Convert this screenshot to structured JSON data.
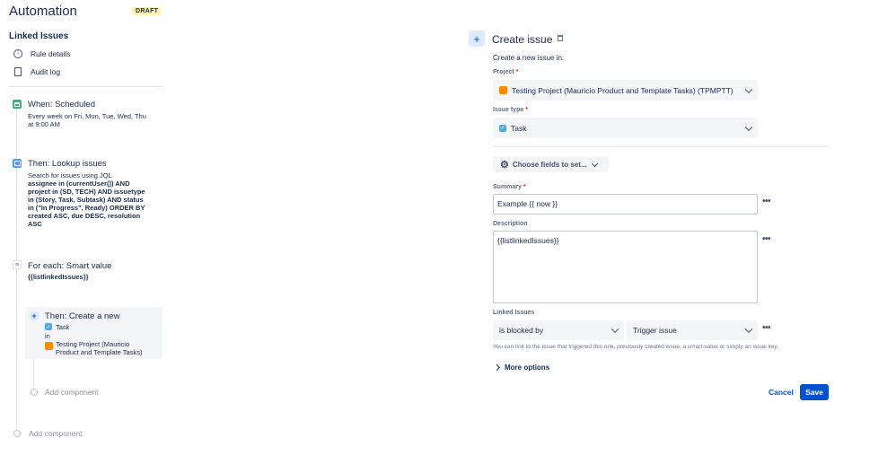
{
  "header": {
    "title": "Automation",
    "badge": "DRAFT"
  },
  "sidebar": {
    "rule_name": "Linked Issues",
    "items": [
      {
        "label": "Rule details",
        "icon": "info-icon"
      },
      {
        "label": "Audit log",
        "icon": "document-icon"
      }
    ]
  },
  "flow": {
    "trigger": {
      "title": "When: Scheduled",
      "lines": [
        "Every week on Fri, Mon, Tue, Wed, Thu",
        "at 9:00 AM"
      ]
    },
    "lookup": {
      "title": "Then: Lookup issues",
      "intro": "Search for issues using JQL",
      "jql_lines": [
        "assignee in (currentUser()) AND",
        "project in (SD, TECH) AND issuetype",
        "in (Story, Task, Subtask) AND status",
        "in (\"In Progress\", Ready) ORDER BY",
        "created ASC, due DESC, resolution",
        "ASC"
      ]
    },
    "branch": {
      "title": "For each: Smart value",
      "value": "{{listlinkedIssues}}"
    },
    "action": {
      "title": "Then: Create a new",
      "type": "Task",
      "in": "in",
      "project_lines": [
        "Testing Project (Mauricio",
        "Product and Template Tasks)"
      ]
    },
    "add_component_inner": "Add component",
    "add_component_outer": "Add component"
  },
  "panel": {
    "title": "Create issue",
    "subtitle": "Create a new issue in:",
    "project": {
      "label": "Project",
      "value": "Testing Project (Mauricio Product and Template Tasks) (TPMPTT)"
    },
    "issue_type": {
      "label": "Issue type",
      "value": "Task"
    },
    "choose_fields": "Choose fields to set...",
    "summary": {
      "label": "Summary",
      "value": "Example {{ now }}"
    },
    "description": {
      "label": "Description",
      "value": "{{listlinkedIssues}}"
    },
    "linked": {
      "label": "Linked Issues",
      "relation": "is blocked by",
      "target": "Trigger issue",
      "help": "You can link to the issue that triggered this rule, previously created issue, a smart-value or simply an issue key."
    },
    "more_options": "More options",
    "cancel": "Cancel",
    "save": "Save"
  },
  "colors": {
    "primary": "#0052cc",
    "draft_bg": "#fff0b3",
    "required": "#de350b",
    "trigger_icon": "#36b37e",
    "action_icon": "#4c9aff"
  }
}
